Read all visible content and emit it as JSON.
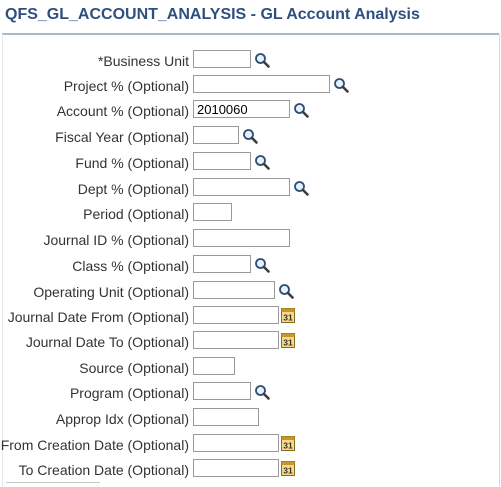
{
  "header": {
    "title": "QFS_GL_ACCOUNT_ANALYSIS - GL Account Analysis"
  },
  "fields": [
    {
      "label": "*Business Unit",
      "value": "",
      "lookup": true,
      "calendar": false
    },
    {
      "label": "Project % (Optional)",
      "value": "",
      "lookup": true,
      "calendar": false
    },
    {
      "label": "Account % (Optional)",
      "value": "2010060",
      "lookup": true,
      "calendar": false
    },
    {
      "label": "Fiscal Year (Optional)",
      "value": "",
      "lookup": true,
      "calendar": false
    },
    {
      "label": "Fund % (Optional)",
      "value": "",
      "lookup": true,
      "calendar": false
    },
    {
      "label": "Dept % (Optional)",
      "value": "",
      "lookup": true,
      "calendar": false
    },
    {
      "label": "Period (Optional)",
      "value": "",
      "lookup": false,
      "calendar": false
    },
    {
      "label": "Journal ID % (Optional)",
      "value": "",
      "lookup": false,
      "calendar": false
    },
    {
      "label": "Class % (Optional)",
      "value": "",
      "lookup": true,
      "calendar": false
    },
    {
      "label": "Operating Unit (Optional)",
      "value": "",
      "lookup": true,
      "calendar": false
    },
    {
      "label": "Journal Date From (Optional)",
      "value": "",
      "lookup": false,
      "calendar": true
    },
    {
      "label": "Journal Date To (Optional)",
      "value": "",
      "lookup": false,
      "calendar": true
    },
    {
      "label": "Source (Optional)",
      "value": "",
      "lookup": false,
      "calendar": false
    },
    {
      "label": "Program (Optional)",
      "value": "",
      "lookup": true,
      "calendar": false
    },
    {
      "label": "Approp Idx (Optional)",
      "value": "",
      "lookup": false,
      "calendar": false
    },
    {
      "label": "From Creation Date (Optional)",
      "value": "",
      "lookup": false,
      "calendar": true
    },
    {
      "label": "To Creation Date (Optional)",
      "value": "",
      "lookup": false,
      "calendar": true
    }
  ],
  "icons": {
    "lookup": "magnifier-lookup-icon",
    "calendar": "calendar-icon"
  },
  "colors": {
    "title": "#2f4f7f",
    "rule": "#a9b9cc",
    "label": "#333333"
  },
  "calendar_glyph": "31"
}
